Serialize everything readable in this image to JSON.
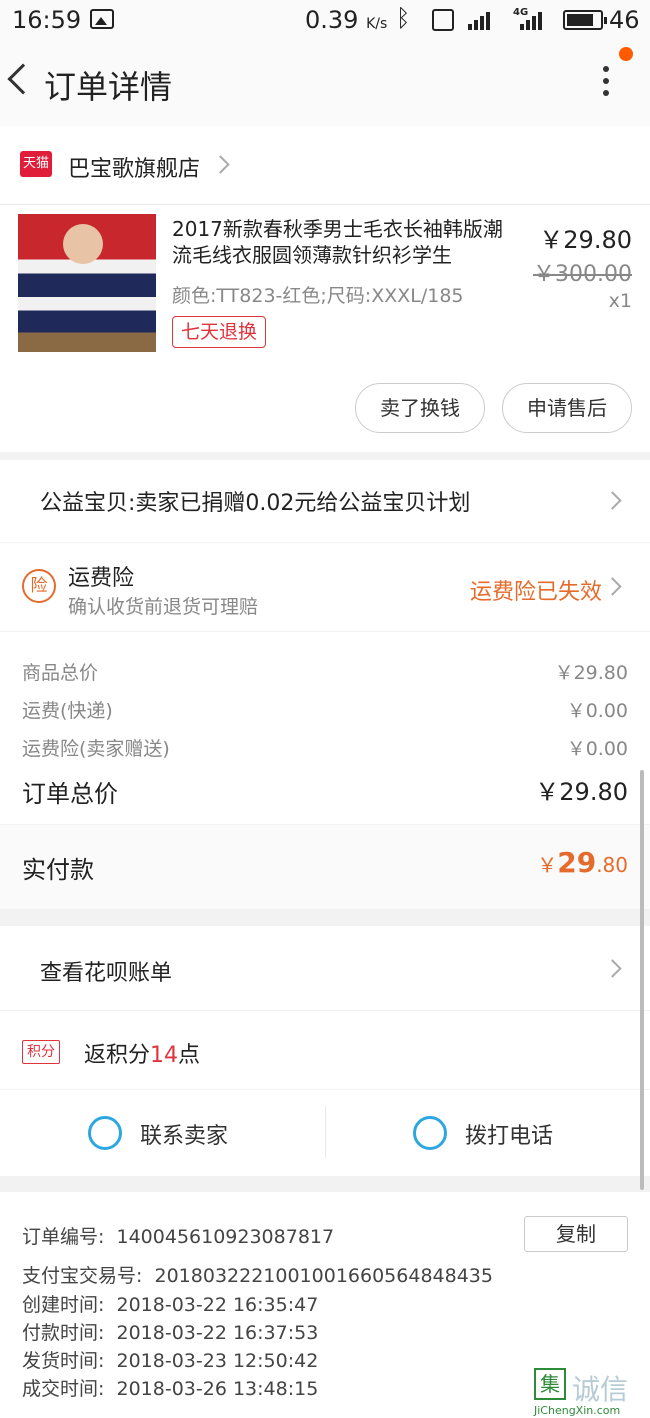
{
  "status_bar": {
    "time": "16:59",
    "speed": "0.39",
    "speed_unit": "K/s",
    "battery": "46",
    "network": "4G"
  },
  "header": {
    "title": "订单详情"
  },
  "shop": {
    "badge": "天猫",
    "name": "巴宝歌旗舰店"
  },
  "product": {
    "title": "2017新款春秋季男士毛衣长袖韩版潮流毛线衣服圆领薄款针织衫学生",
    "spec": "颜色:TT823-红色;尺码:XXXL/185",
    "badge": "七天退换",
    "price": "￥29.80",
    "original_price": "￥300.00",
    "quantity": "x1"
  },
  "actions": {
    "sell_label": "卖了换钱",
    "aftersale_label": "申请售后"
  },
  "charity": {
    "text": "公益宝贝:卖家已捐赠0.02元给公益宝贝计划"
  },
  "insurance": {
    "icon_char": "险",
    "title": "运费险",
    "subtitle": "确认收货前退货可理赔",
    "status": "运费险已失效"
  },
  "summary": {
    "rows": [
      {
        "label": "商品总价",
        "value": "￥29.80"
      },
      {
        "label": "运费(快递)",
        "value": "￥0.00"
      },
      {
        "label": "运费险(卖家赠送)",
        "value": "￥0.00"
      }
    ],
    "total_label": "订单总价",
    "total_value": "￥29.80",
    "paid_label": "实付款",
    "paid_symbol": "￥",
    "paid_int": "29",
    "paid_dec": ".80"
  },
  "huabei": {
    "label": "查看花呗账单"
  },
  "points": {
    "icon": "积分",
    "prefix": "返积分",
    "count": "14",
    "suffix": "点"
  },
  "contact": {
    "seller_label": "联系卖家",
    "phone_label": "拨打电话"
  },
  "order_info": {
    "order_no_label": "订单编号:",
    "order_no": "140045610923087817",
    "copy_label": "复制",
    "alipay_label": "支付宝交易号:",
    "alipay_no": "2018032221001001660564848435",
    "created_label": "创建时间:",
    "created": "2018-03-22 16:35:47",
    "paid_label": "付款时间:",
    "paid": "2018-03-22 16:37:53",
    "shipped_label": "发货时间:",
    "shipped": "2018-03-23 12:50:42",
    "closed_label": "成交时间:",
    "closed": "2018-03-26 13:48:15"
  },
  "watermark": {
    "char": "集",
    "text": "诚信",
    "url": "JiChengXin.com"
  },
  "colors": {
    "accent": "#e56b2c",
    "tmall_red": "#e01e3a",
    "link_blue": "#2ea7e0"
  }
}
